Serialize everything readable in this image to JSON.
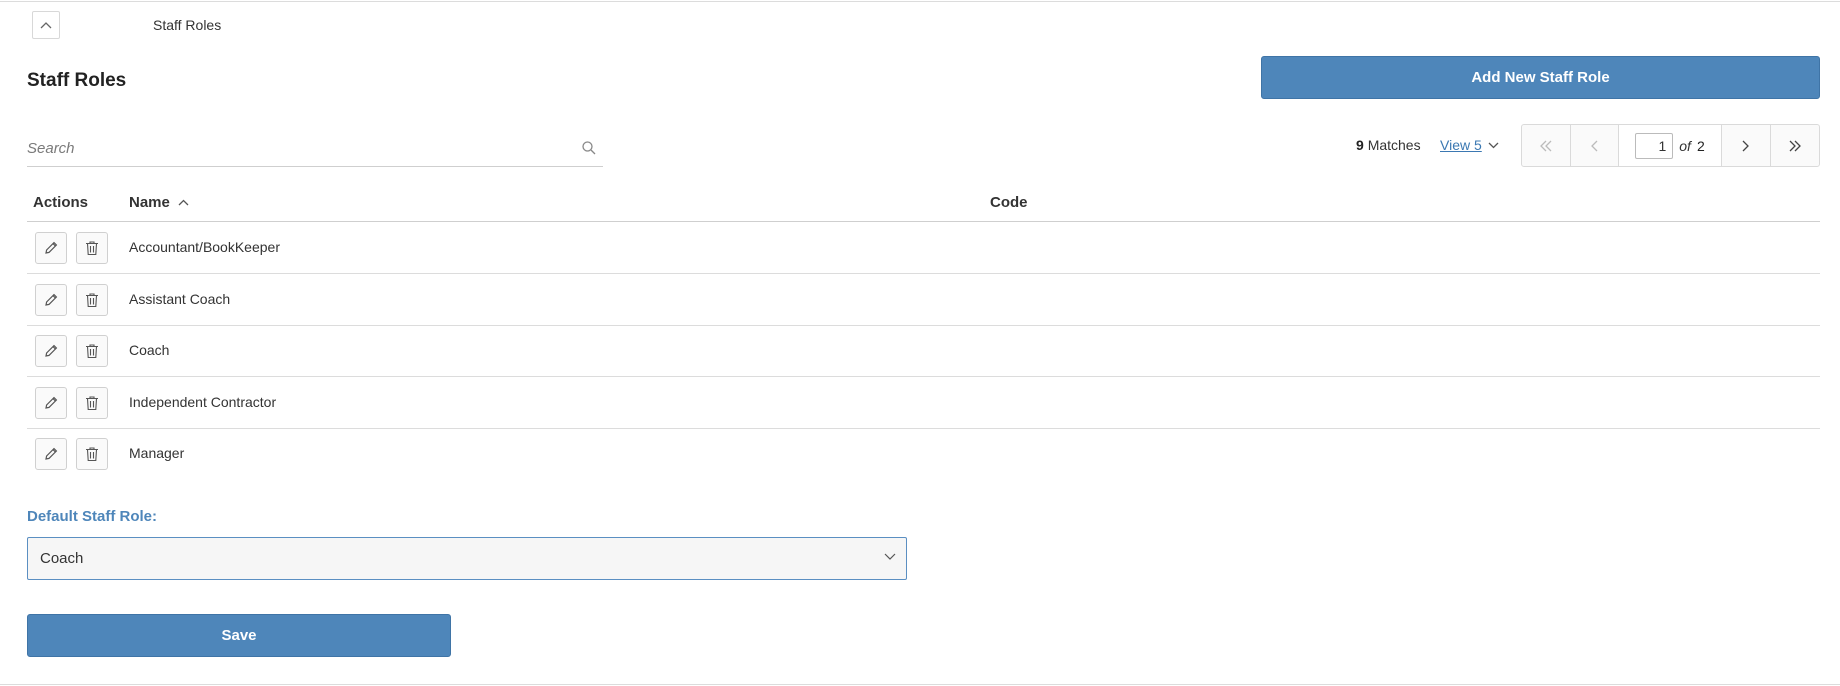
{
  "breadcrumb": {
    "label": "Staff Roles"
  },
  "page": {
    "title": "Staff Roles"
  },
  "toolbar": {
    "add_label": "Add New Staff Role"
  },
  "search": {
    "placeholder": "Search",
    "value": ""
  },
  "results": {
    "count": "9",
    "matches_label": "Matches",
    "view_label": "View 5"
  },
  "pager": {
    "current_page": "1",
    "of_label": "of",
    "total_pages": "2"
  },
  "table": {
    "columns": {
      "actions": "Actions",
      "name": "Name",
      "code": "Code"
    },
    "rows": [
      {
        "name": "Accountant/BookKeeper",
        "code": ""
      },
      {
        "name": "Assistant Coach",
        "code": ""
      },
      {
        "name": "Coach",
        "code": ""
      },
      {
        "name": "Independent Contractor",
        "code": ""
      },
      {
        "name": "Manager",
        "code": ""
      }
    ]
  },
  "default_role": {
    "label": "Default Staff Role:",
    "selected": "Coach"
  },
  "form": {
    "save_label": "Save"
  },
  "colors": {
    "accent": "#4e86ba",
    "link": "#3b78b2"
  }
}
